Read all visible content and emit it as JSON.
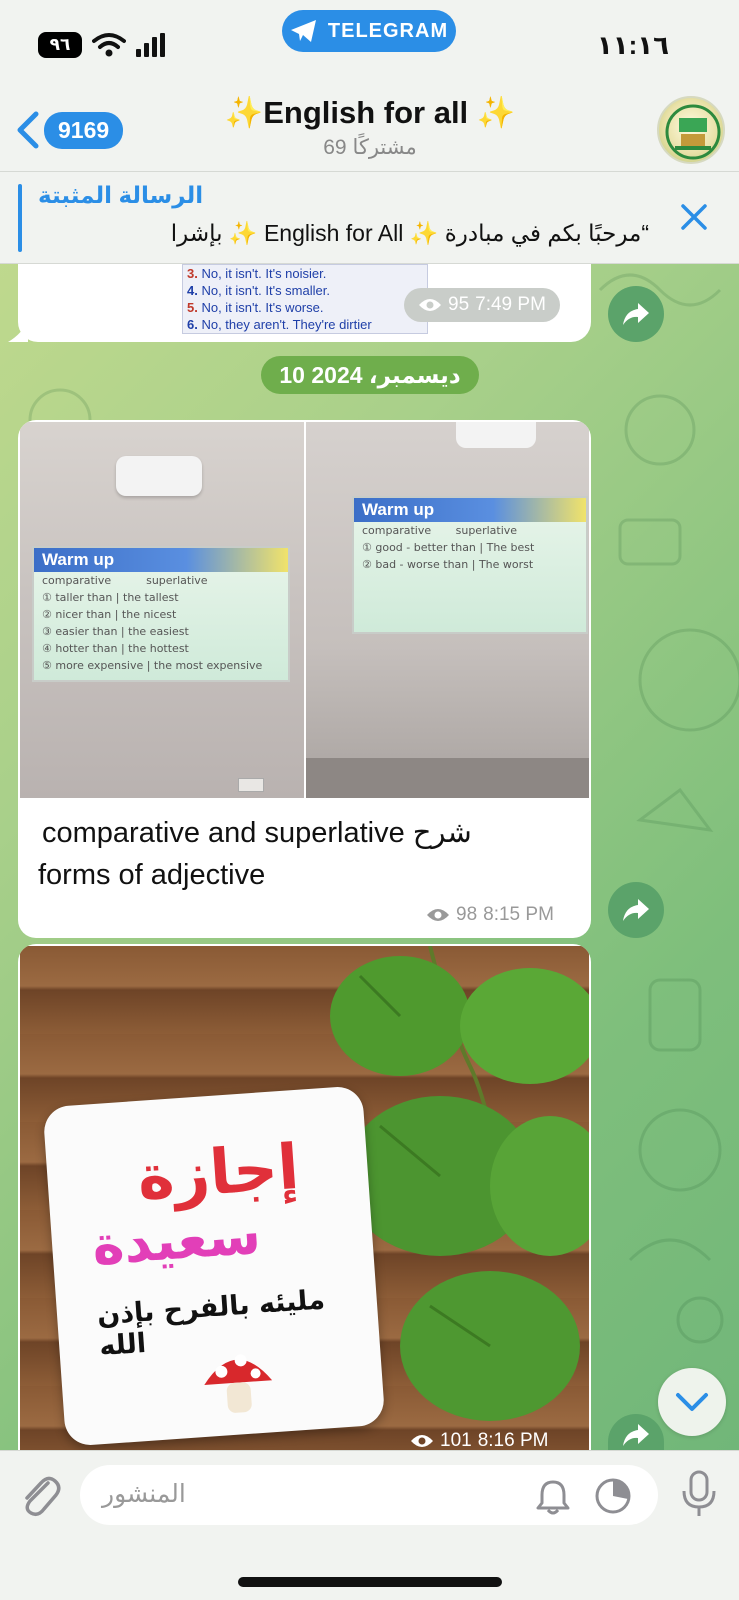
{
  "status_bar": {
    "battery": "٩٦",
    "app_pill": "TELEGRAM",
    "time": "١١:١٦"
  },
  "header": {
    "back_count": "9169",
    "title": "✨English for all ✨",
    "subtitle": "69 مشتركًا"
  },
  "pinned": {
    "label": "الرسالة المثبتة",
    "text": "“مرحبًا بكم في مبادرة ✨ English for All ✨ بإشرا"
  },
  "messages": {
    "prev": {
      "lines": [
        {
          "num": "3.",
          "text": "No, it isn't. It's noisier.",
          "color": "#c0392b"
        },
        {
          "num": "4.",
          "text": "No, it isn't. It's smaller.",
          "color": "#1f3fa8"
        },
        {
          "num": "5.",
          "text": "No, it isn't. It's worse.",
          "color": "#c0392b"
        },
        {
          "num": "6.",
          "text": "No, they aren't. They're dirtier",
          "color": "#1f3fa8"
        }
      ],
      "views": "95",
      "time": "7:49 PM"
    },
    "date_divider": "10 ديسمبر، 2024",
    "album": {
      "left_photo": {
        "title": "Warm up",
        "col1": "comparative",
        "col2": "superlative",
        "rows": [
          "① taller than  |  the tallest",
          "② nicer than  |  the nicest",
          "③ easier than  |  the easiest",
          "④ hotter than  |  the hottest",
          "⑤ more expensive  |  the most expensive"
        ]
      },
      "right_photo": {
        "title": "Warm up",
        "col1": "comparative",
        "col2": "superlative",
        "rows": [
          "① good - better than  |  The best",
          "② bad - worse than  |  The worst"
        ]
      },
      "caption_line1": "comparative and superlative شرح",
      "caption_line2": "forms of adjective",
      "views": "98",
      "time": "8:15 PM"
    },
    "holiday": {
      "word1": "إجازة",
      "word2": "سعيدة",
      "line3": "مليئه بالفرح بإذن الله",
      "views": "101",
      "time": "8:16 PM"
    }
  },
  "composer": {
    "placeholder": "المنشور"
  },
  "icons": {
    "back": "chevron-left-icon",
    "close": "close-icon",
    "forward": "share-icon",
    "eye": "eye-icon",
    "attach": "paperclip-icon",
    "bell": "bell-icon",
    "timer": "timer-icon",
    "mic": "mic-icon",
    "scroll": "chevron-down-icon"
  },
  "colors": {
    "accent": "#2b8ee6",
    "date_pill": "#6fae4c",
    "forward_btn": "#5ba36a"
  }
}
